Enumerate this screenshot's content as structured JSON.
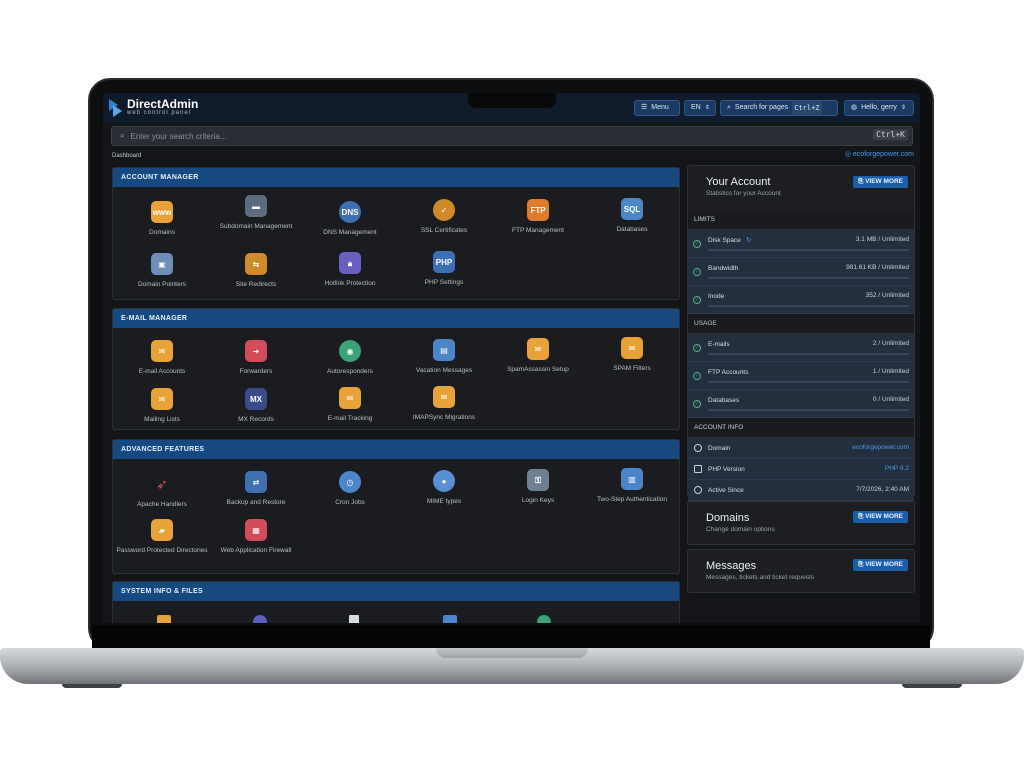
{
  "app": {
    "logo_title": "DirectAdmin",
    "logo_sub": "web control panel"
  },
  "topbar": {
    "menu_label": "Menu",
    "lang_label": "EN",
    "search_label": "Search for pages",
    "search_kbd": "Ctrl+Z",
    "user_label": "Hello, gerry"
  },
  "search": {
    "placeholder": "Enter your search criteria...",
    "kbd": "Ctrl+K"
  },
  "breadcrumb": "Dashboard",
  "site": "ecoforgepower.com",
  "sections": [
    {
      "title": "ACCOUNT MANAGER",
      "items": [
        {
          "label": "Domains",
          "icon": "www-icon"
        },
        {
          "label": "Subdomain Management",
          "icon": "subdomain-icon"
        },
        {
          "label": "DNS Management",
          "icon": "dns-icon"
        },
        {
          "label": "SSL Certificates",
          "icon": "ssl-badge-icon"
        },
        {
          "label": "FTP Management",
          "icon": "ftp-icon"
        },
        {
          "label": "Databases",
          "icon": "sql-icon"
        },
        {
          "label": "Domain Pointers",
          "icon": "pointer-icon"
        },
        {
          "label": "Site Redirects",
          "icon": "signpost-icon"
        },
        {
          "label": "Hotlink Protection",
          "icon": "lock-icon"
        },
        {
          "label": "PHP Settings",
          "icon": "php-icon"
        }
      ]
    },
    {
      "title": "E-MAIL MANAGER",
      "items": [
        {
          "label": "E-mail Accounts",
          "icon": "mail-icon"
        },
        {
          "label": "Forwarders",
          "icon": "forward-icon"
        },
        {
          "label": "Autoresponders",
          "icon": "autoresponder-icon"
        },
        {
          "label": "Vacation Messages",
          "icon": "vacation-icon"
        },
        {
          "label": "SpamAssassin Setup",
          "icon": "spam-setup-icon"
        },
        {
          "label": "SPAM Filters",
          "icon": "spam-filter-icon"
        },
        {
          "label": "Mailing Lists",
          "icon": "mailing-list-icon"
        },
        {
          "label": "MX Records",
          "icon": "mx-icon"
        },
        {
          "label": "E-mail Tracking",
          "icon": "tracking-icon"
        },
        {
          "label": "IMAPSync Migrations",
          "icon": "imapsync-icon"
        }
      ]
    },
    {
      "title": "ADVANCED FEATURES",
      "items": [
        {
          "label": "Apache Handlers",
          "icon": "feather-icon"
        },
        {
          "label": "Backup and Restore",
          "icon": "backup-icon"
        },
        {
          "label": "Cron Jobs",
          "icon": "clock-icon"
        },
        {
          "label": "MIME types",
          "icon": "mime-icon"
        },
        {
          "label": "Login Keys",
          "icon": "key-icon"
        },
        {
          "label": "Two-Step Authentication",
          "icon": "two-step-icon"
        },
        {
          "label": "Password Protected Directories",
          "icon": "password-folder-icon"
        },
        {
          "label": "Web Application Firewall",
          "icon": "firewall-icon"
        }
      ]
    },
    {
      "title": "SYSTEM INFO & FILES"
    }
  ],
  "account": {
    "title": "Your Account",
    "subtitle": "Statistics for your Account",
    "view_more": "VIEW MORE",
    "limits_label": "LIMITS",
    "limits": [
      {
        "name": "Disk Space",
        "value": "3.1 MB / Unlimited"
      },
      {
        "name": "Bandwidth",
        "value": "981.61 KB / Unlimited"
      },
      {
        "name": "Inode",
        "value": "352 / Unlimited"
      }
    ],
    "usage_label": "USAGE",
    "usage": [
      {
        "name": "E-mails",
        "value": "2 / Unlimited"
      },
      {
        "name": "FTP Accounts",
        "value": "1 / Unlimited"
      },
      {
        "name": "Databases",
        "value": "0 / Unlimited"
      }
    ],
    "info_label": "ACCOUNT INFO",
    "info": [
      {
        "name": "Domain",
        "value": "ecoforgepower.com"
      },
      {
        "name": "PHP Version",
        "value": "PHP 8.2"
      },
      {
        "name": "Active Since",
        "value": "7/7/2026, 2:40 AM"
      }
    ]
  },
  "domains_box": {
    "title": "Domains",
    "subtitle": "Change domain options",
    "view_more": "VIEW MORE"
  },
  "messages_box": {
    "title": "Messages",
    "subtitle": "Messages, tickets and ticket requests",
    "view_more": "VIEW MORE"
  },
  "colors": {
    "accent": "#15497f",
    "link": "#4a9be8",
    "bg": "#141518"
  }
}
